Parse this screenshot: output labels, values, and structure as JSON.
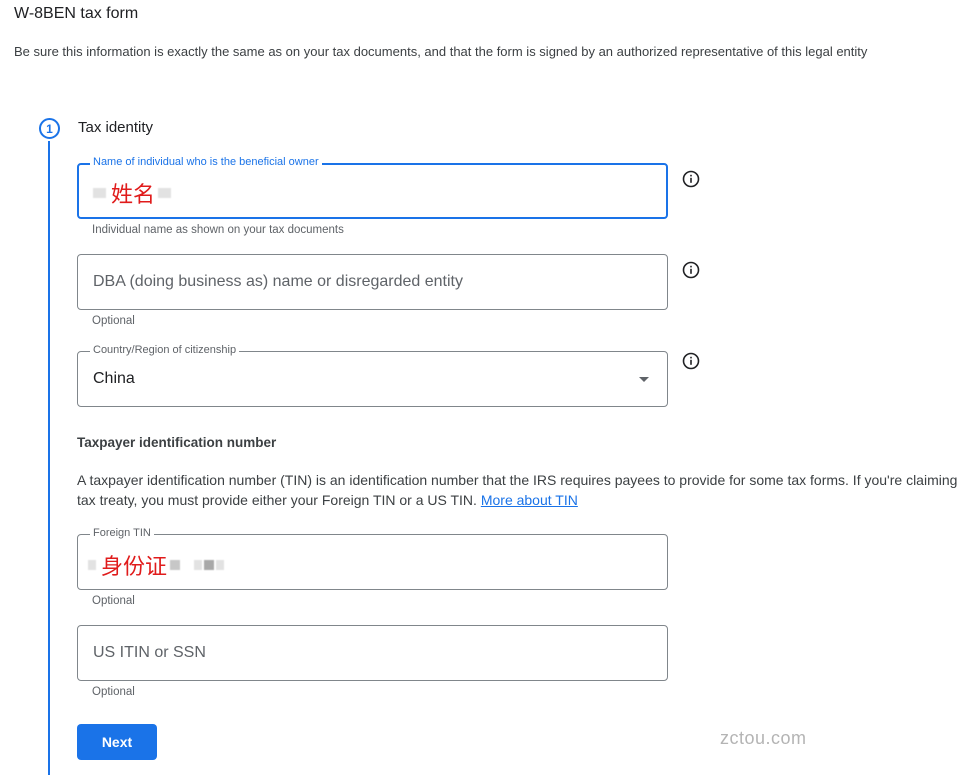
{
  "page": {
    "title": "W-8BEN tax form",
    "subtitle": "Be sure this information is exactly the same as on your tax documents, and that the form is signed by an authorized representative of this legal entity"
  },
  "step": {
    "number": "1",
    "title": "Tax identity"
  },
  "fields": {
    "beneficial_owner": {
      "label": "Name of individual who is the beneficial owner",
      "annotation": "姓名",
      "helper": "Individual name as shown on your tax documents"
    },
    "dba": {
      "placeholder": "DBA (doing business as) name or disregarded entity",
      "helper": "Optional"
    },
    "citizenship": {
      "label": "Country/Region of citizenship",
      "value": "China"
    },
    "foreign_tin": {
      "label": "Foreign TIN",
      "annotation": "身份证",
      "helper": "Optional"
    },
    "us_tin": {
      "placeholder": "US ITIN or SSN",
      "helper": "Optional"
    }
  },
  "tin_section": {
    "heading": "Taxpayer identification number",
    "description_line1": "A taxpayer identification number (TIN) is an identification number that the IRS requires payees to provide for some tax forms. If you're claiming",
    "description_line2": "tax treaty, you must provide either your Foreign TIN or a US TIN.",
    "link": "More about TIN"
  },
  "actions": {
    "next_label": "Next"
  },
  "watermark": "zctou.com",
  "colors": {
    "accent": "#1a73e8",
    "annotation_red": "#e01b1b"
  }
}
